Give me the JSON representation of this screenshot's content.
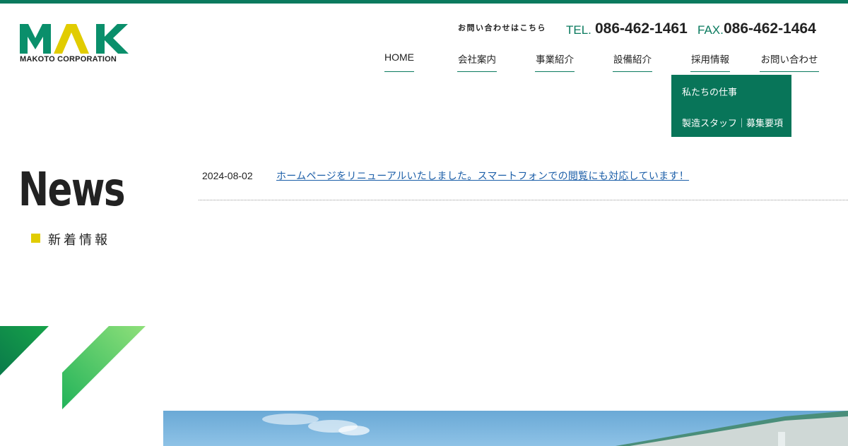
{
  "header": {
    "logo_text": "MAK",
    "logo_sub": "MAKOTO CORPORATION",
    "contact_label": "お問い合わせはこちら",
    "tel_prefix": "TEL.",
    "tel_number": "086-462-1461",
    "fax_prefix": "FAX.",
    "fax_number": "086-462-1464"
  },
  "nav": {
    "items": [
      {
        "label": "HOME"
      },
      {
        "label": "会社案内"
      },
      {
        "label": "事業紹介"
      },
      {
        "label": "設備紹介"
      },
      {
        "label": "採用情報"
      },
      {
        "label": "お問い合わせ"
      }
    ],
    "dropdown": [
      {
        "label": "私たちの仕事"
      },
      {
        "label": "製造スタッフ｜募集要項"
      }
    ]
  },
  "news": {
    "title": "News",
    "subtitle": "新着情報",
    "items": [
      {
        "date": "2024-08-02",
        "text": "ホームページをリニューアルいたしました。スマートフォンでの閲覧にも対応しています！"
      }
    ]
  },
  "colors": {
    "brand_green": "#0a7a5e",
    "brand_yellow": "#e1cc00",
    "link": "#1b5ea8"
  }
}
